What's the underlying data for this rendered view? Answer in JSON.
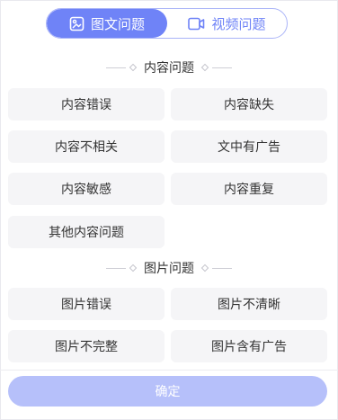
{
  "tabs": [
    {
      "label": "图文问题",
      "icon": "image-text-icon",
      "active": true
    },
    {
      "label": "视频问题",
      "icon": "video-icon",
      "active": false
    }
  ],
  "sections": [
    {
      "title": "内容问题",
      "options": [
        "内容错误",
        "内容缺失",
        "内容不相关",
        "文中有广告",
        "内容敏感",
        "内容重复",
        "其他内容问题"
      ]
    },
    {
      "title": "图片问题",
      "options": [
        "图片错误",
        "图片不清晰",
        "图片不完整",
        "图片含有广告"
      ]
    }
  ],
  "confirm_label": "确定",
  "colors": {
    "accent": "#6f83f7",
    "accent_light": "#b6c0fa",
    "option_bg": "#f5f5f7"
  }
}
